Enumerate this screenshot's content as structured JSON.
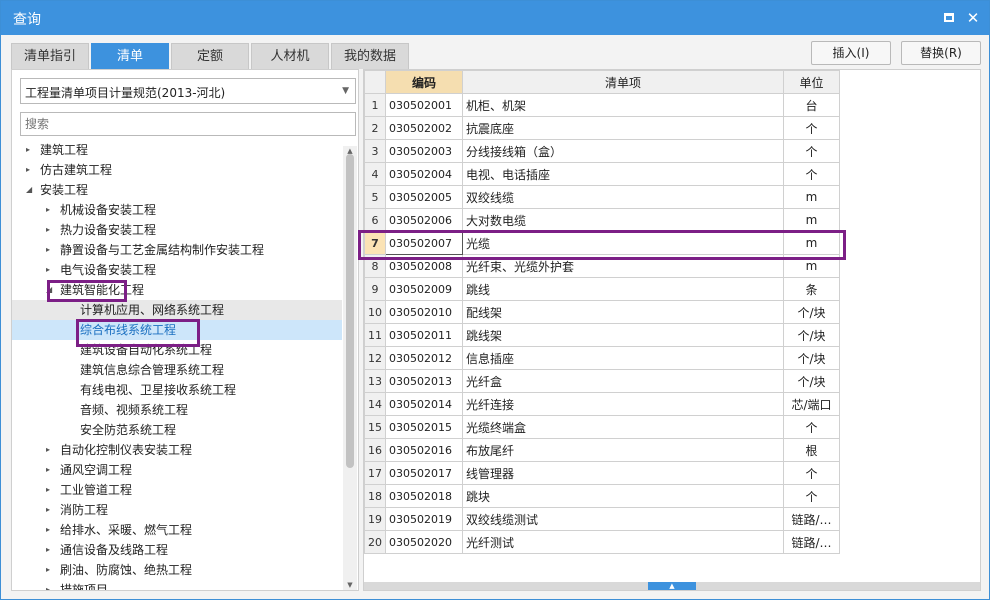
{
  "window": {
    "title": "查询",
    "maximize_icon": "maximize-icon",
    "close_icon": "close-icon",
    "close_glyph": "✕"
  },
  "tabs": [
    {
      "label": "清单指引",
      "active": false
    },
    {
      "label": "清单",
      "active": true
    },
    {
      "label": "定额",
      "active": false
    },
    {
      "label": "人材机",
      "active": false
    },
    {
      "label": "我的数据",
      "active": false
    }
  ],
  "actions": {
    "insert_label": "插入(I)",
    "replace_label": "替换(R)"
  },
  "left": {
    "spec_select": "工程量清单项目计量规范(2013-河北)",
    "search_placeholder": "搜索",
    "tree": [
      {
        "label": "建筑工程",
        "level": 0,
        "caret": "▸"
      },
      {
        "label": "仿古建筑工程",
        "level": 0,
        "caret": "▸"
      },
      {
        "label": "安装工程",
        "level": 0,
        "caret": "◢"
      },
      {
        "label": "机械设备安装工程",
        "level": 1,
        "caret": "▸"
      },
      {
        "label": "热力设备安装工程",
        "level": 1,
        "caret": "▸"
      },
      {
        "label": "静置设备与工艺金属结构制作安装工程",
        "level": 1,
        "caret": "▸"
      },
      {
        "label": "电气设备安装工程",
        "level": 1,
        "caret": "▸"
      },
      {
        "label": "建筑智能化工程",
        "level": 1,
        "caret": "◢"
      },
      {
        "label": "计算机应用、网络系统工程",
        "level": 2,
        "caret": "",
        "state": "hover"
      },
      {
        "label": "综合布线系统工程",
        "level": 2,
        "caret": "",
        "state": "selected"
      },
      {
        "label": "建筑设备自动化系统工程",
        "level": 2,
        "caret": ""
      },
      {
        "label": "建筑信息综合管理系统工程",
        "level": 2,
        "caret": ""
      },
      {
        "label": "有线电视、卫星接收系统工程",
        "level": 2,
        "caret": ""
      },
      {
        "label": "音频、视频系统工程",
        "level": 2,
        "caret": ""
      },
      {
        "label": "安全防范系统工程",
        "level": 2,
        "caret": ""
      },
      {
        "label": "自动化控制仪表安装工程",
        "level": 1,
        "caret": "▸"
      },
      {
        "label": "通风空调工程",
        "level": 1,
        "caret": "▸"
      },
      {
        "label": "工业管道工程",
        "level": 1,
        "caret": "▸"
      },
      {
        "label": "消防工程",
        "level": 1,
        "caret": "▸"
      },
      {
        "label": "给排水、采暖、燃气工程",
        "level": 1,
        "caret": "▸"
      },
      {
        "label": "通信设备及线路工程",
        "level": 1,
        "caret": "▸"
      },
      {
        "label": "刷油、防腐蚀、绝热工程",
        "level": 1,
        "caret": "▸"
      },
      {
        "label": "措施项目",
        "level": 1,
        "caret": "▸"
      }
    ]
  },
  "grid": {
    "headers": {
      "code": "编码",
      "item": "清单项",
      "unit": "单位"
    },
    "rows": [
      {
        "idx": "1",
        "code": "030502001",
        "item": "机柜、机架",
        "unit": "台"
      },
      {
        "idx": "2",
        "code": "030502002",
        "item": "抗震底座",
        "unit": "个"
      },
      {
        "idx": "3",
        "code": "030502003",
        "item": "分线接线箱（盒）",
        "unit": "个"
      },
      {
        "idx": "4",
        "code": "030502004",
        "item": "电视、电话插座",
        "unit": "个"
      },
      {
        "idx": "5",
        "code": "030502005",
        "item": "双绞线缆",
        "unit": "m"
      },
      {
        "idx": "6",
        "code": "030502006",
        "item": "大对数电缆",
        "unit": "m"
      },
      {
        "idx": "7",
        "code": "030502007",
        "item": "光缆",
        "unit": "m",
        "current": true
      },
      {
        "idx": "8",
        "code": "030502008",
        "item": "光纤束、光缆外护套",
        "unit": "m"
      },
      {
        "idx": "9",
        "code": "030502009",
        "item": "跳线",
        "unit": "条"
      },
      {
        "idx": "10",
        "code": "030502010",
        "item": "配线架",
        "unit": "个/块"
      },
      {
        "idx": "11",
        "code": "030502011",
        "item": "跳线架",
        "unit": "个/块"
      },
      {
        "idx": "12",
        "code": "030502012",
        "item": "信息插座",
        "unit": "个/块"
      },
      {
        "idx": "13",
        "code": "030502013",
        "item": "光纤盒",
        "unit": "个/块"
      },
      {
        "idx": "14",
        "code": "030502014",
        "item": "光纤连接",
        "unit": "芯/端口"
      },
      {
        "idx": "15",
        "code": "030502015",
        "item": "光缆终端盒",
        "unit": "个"
      },
      {
        "idx": "16",
        "code": "030502016",
        "item": "布放尾纤",
        "unit": "根"
      },
      {
        "idx": "17",
        "code": "030502017",
        "item": "线管理器",
        "unit": "个"
      },
      {
        "idx": "18",
        "code": "030502018",
        "item": "跳块",
        "unit": "个"
      },
      {
        "idx": "19",
        "code": "030502019",
        "item": "双绞线缆测试",
        "unit": "链路/…"
      },
      {
        "idx": "20",
        "code": "030502020",
        "item": "光纤测试",
        "unit": "链路/…"
      }
    ]
  },
  "colors": {
    "accent": "#3d92de",
    "highlight_box": "#7c1f86",
    "selected_row": "#cde6fa",
    "code_header": "#f5deb0"
  }
}
